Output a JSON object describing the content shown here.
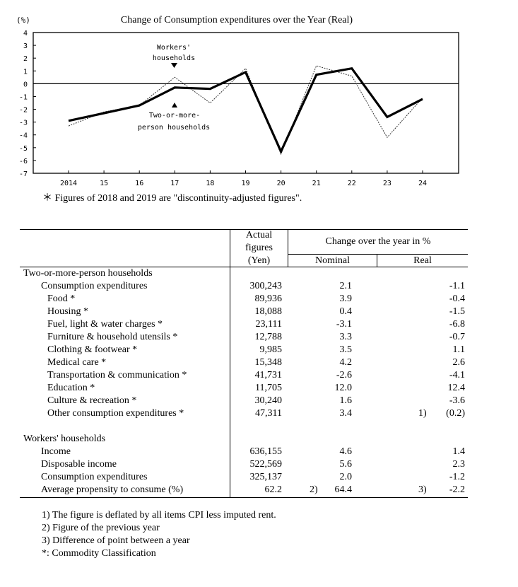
{
  "chart_data": {
    "type": "line",
    "title": "Change of Consumption  expenditures over the Year (Real)",
    "ylabel": "(%)",
    "xlabel": "",
    "ylim": [
      -7,
      4
    ],
    "yticks": [
      "4",
      "3",
      "2",
      "1",
      "0",
      "-1",
      "-2",
      "-3",
      "-4",
      "-5",
      "-6",
      "-7"
    ],
    "categories": [
      "2014",
      "15",
      "16",
      "17",
      "18",
      "19",
      "20",
      "21",
      "22",
      "23",
      "24"
    ],
    "grid": false,
    "zero_line": true,
    "series": [
      {
        "name": "Workers' households",
        "style": "solid-thick",
        "values": [
          -2.9,
          -2.3,
          -1.7,
          -0.3,
          -0.4,
          0.9,
          -5.3,
          0.7,
          1.2,
          -2.6,
          -1.2
        ]
      },
      {
        "name": "Two-or-more-person households",
        "style": "dotted",
        "values": [
          -3.3,
          -2.2,
          -1.7,
          0.5,
          -1.5,
          1.2,
          -5.5,
          1.4,
          0.6,
          -4.2,
          -1.1
        ]
      }
    ],
    "annotations": {
      "workers_line1": "Workers'",
      "workers_line2": "households",
      "two_line1": "Two-or-more-",
      "two_line2": "person households"
    },
    "footnote": "＊ Figures of  2018 and 2019  are  \"discontinuity-adjusted figures\"."
  },
  "table": {
    "header": {
      "actual_l1": "Actual",
      "actual_l2": "figures",
      "actual_l3": "(Yen)",
      "change": "Change over the year in %",
      "nominal": "Nominal",
      "real": "Real"
    },
    "sections": [
      {
        "title": "Two-or-more-person households",
        "rows": [
          {
            "label": "Consumption expenditures",
            "indent": 1,
            "actual": "300,243",
            "nominal_note": "",
            "nominal": "2.1",
            "real_note": "",
            "real": "-1.1"
          },
          {
            "label": "Food *",
            "indent": 2,
            "actual": "89,936",
            "nominal_note": "",
            "nominal": "3.9",
            "real_note": "",
            "real": "-0.4"
          },
          {
            "label": "Housing *",
            "indent": 2,
            "actual": "18,088",
            "nominal_note": "",
            "nominal": "0.4",
            "real_note": "",
            "real": "-1.5"
          },
          {
            "label": "Fuel, light & water charges *",
            "indent": 2,
            "actual": "23,111",
            "nominal_note": "",
            "nominal": "-3.1",
            "real_note": "",
            "real": "-6.8"
          },
          {
            "label": "Furniture & household utensils *",
            "indent": 2,
            "actual": "12,788",
            "nominal_note": "",
            "nominal": "3.3",
            "real_note": "",
            "real": "-0.7"
          },
          {
            "label": "Clothing & footwear *",
            "indent": 2,
            "actual": "9,985",
            "nominal_note": "",
            "nominal": "3.5",
            "real_note": "",
            "real": "1.1"
          },
          {
            "label": "Medical care *",
            "indent": 2,
            "actual": "15,348",
            "nominal_note": "",
            "nominal": "4.2",
            "real_note": "",
            "real": "2.6"
          },
          {
            "label": "Transportation & communication *",
            "indent": 2,
            "actual": "41,731",
            "nominal_note": "",
            "nominal": "-2.6",
            "real_note": "",
            "real": "-4.1"
          },
          {
            "label": "Education *",
            "indent": 2,
            "actual": "11,705",
            "nominal_note": "",
            "nominal": "12.0",
            "real_note": "",
            "real": "12.4"
          },
          {
            "label": "Culture & recreation *",
            "indent": 2,
            "actual": "30,240",
            "nominal_note": "",
            "nominal": "1.6",
            "real_note": "",
            "real": "-3.6"
          },
          {
            "label": "Other consumption expenditures *",
            "indent": 2,
            "actual": "47,311",
            "nominal_note": "",
            "nominal": "3.4",
            "real_note": "1)",
            "real": "(0.2)"
          }
        ]
      },
      {
        "title": "Workers' households",
        "rows": [
          {
            "label": "Income",
            "indent": 1,
            "actual": "636,155",
            "nominal_note": "",
            "nominal": "4.6",
            "real_note": "",
            "real": "1.4"
          },
          {
            "label": "Disposable income",
            "indent": 1,
            "actual": "522,569",
            "nominal_note": "",
            "nominal": "5.6",
            "real_note": "",
            "real": "2.3"
          },
          {
            "label": "Consumption expenditures",
            "indent": 1,
            "actual": "325,137",
            "nominal_note": "",
            "nominal": "2.0",
            "real_note": "",
            "real": "-1.2"
          },
          {
            "label": "Average propensity to consume (%)",
            "indent": 1,
            "actual": "62.2",
            "nominal_note": "2)",
            "nominal": "64.4",
            "real_note": "3)",
            "real": "-2.2"
          }
        ]
      }
    ],
    "notes": [
      "1) The figure is deflated by all items CPI less imputed rent.",
      "2) Figure of the previous year",
      "3) Difference of point between a year",
      "*: Commodity Classification"
    ]
  }
}
